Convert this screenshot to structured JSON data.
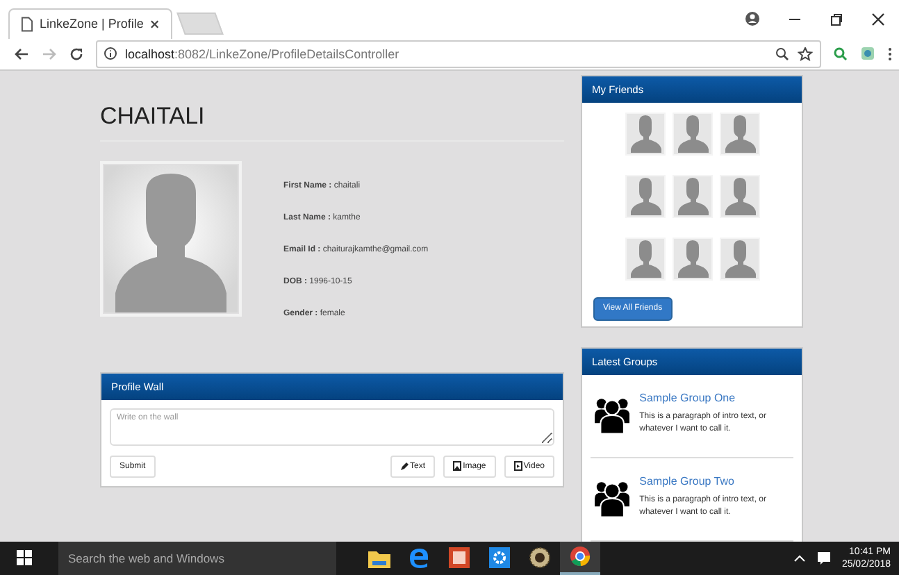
{
  "browser": {
    "tab_title": "LinkeZone | Profile",
    "url_host": "localhost",
    "url_path": ":8082/LinkeZone/ProfileDetailsController"
  },
  "profile": {
    "name": "CHAITALI",
    "fields": [
      "**First Name :** chaitali",
      "**Last Name :** kamthe",
      "**Email Id :** chaiturajkamthe@gmail.com",
      "**DOB :** 1996-10-15",
      "**Gender :** female"
    ]
  },
  "wall": {
    "title": "Profile Wall",
    "placeholder": "Write on the wall",
    "submit": "Submit",
    "post_buttons": [
      {
        "kind": "text",
        "label": "Text"
      },
      {
        "kind": "image",
        "label": "Image"
      },
      {
        "kind": "video",
        "label": "Video"
      }
    ]
  },
  "friends": {
    "title": "My Friends",
    "avatars": [
      {
        "kind": "avatar"
      },
      {
        "kind": "avatar"
      },
      {
        "kind": "avatar"
      },
      {
        "kind": "avatar"
      },
      {
        "kind": "avatar"
      },
      {
        "kind": "avatar"
      },
      {
        "kind": "avatar"
      },
      {
        "kind": "avatar"
      },
      {
        "kind": "avatar"
      }
    ],
    "button": "View All Friends"
  },
  "groups": {
    "title": "Latest Groups",
    "items": [
      {
        "name": "Sample Group One",
        "description": "This is a paragraph of intro text, or whatever I want to call it."
      },
      {
        "name": "Sample Group Two",
        "description": "This is a paragraph of intro text, or whatever I want to call it."
      }
    ]
  },
  "taskbar": {
    "search_placeholder": "Search the web and Windows",
    "apps": [
      {
        "kind": "folder"
      },
      {
        "kind": "edge"
      },
      {
        "kind": "slides"
      },
      {
        "kind": "gear"
      },
      {
        "kind": "badge"
      },
      {
        "kind": "chrome"
      }
    ],
    "time": "10:41 PM",
    "date": "25/02/2018"
  }
}
